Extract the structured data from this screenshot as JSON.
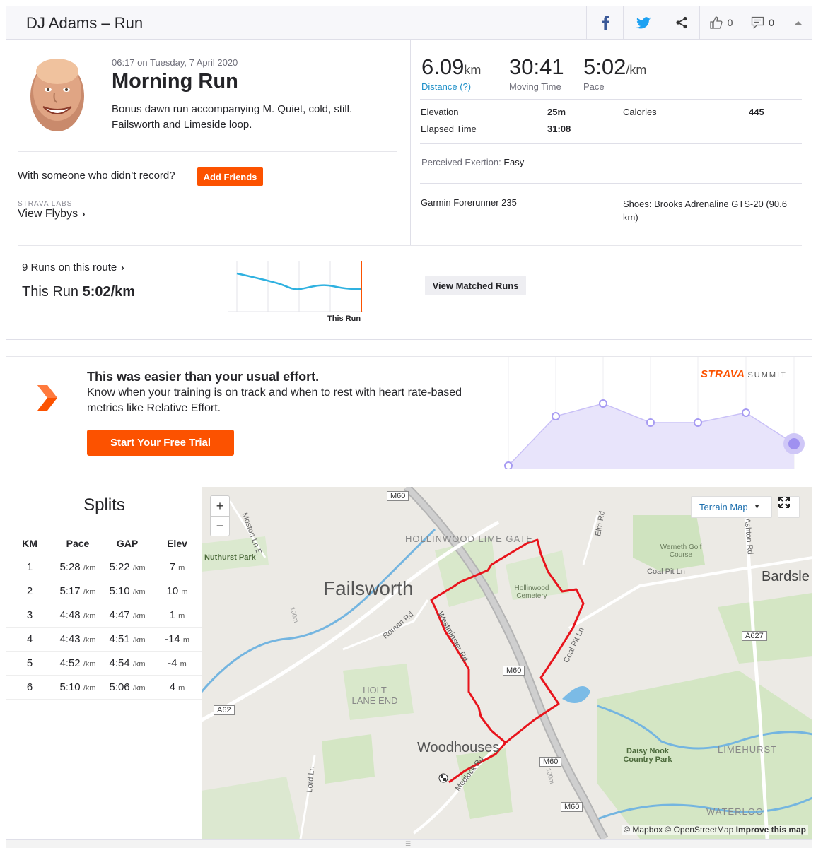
{
  "header": {
    "title": "DJ Adams – Run",
    "kudos_count": "0",
    "comments_count": "0",
    "icons": [
      "facebook-icon",
      "twitter-icon",
      "share-icon",
      "thumbs-up-icon",
      "comment-icon",
      "collapse-icon"
    ]
  },
  "activity": {
    "datetime": "06:17 on Tuesday, 7 April 2020",
    "name": "Morning Run",
    "description": "Bonus dawn run accompanying M. Quiet, cold, still. Failsworth and Limeside loop.",
    "with_someone": "With someone who didn’t record?",
    "add_friends": "Add Friends",
    "labs_label": "STRAVA LABS",
    "flybys": "View Flybys"
  },
  "stats": {
    "distance": {
      "value": "6.09",
      "unit": "km",
      "label": "Distance (?)"
    },
    "moving_time": {
      "value": "30:41",
      "label": "Moving Time"
    },
    "pace": {
      "value": "5:02",
      "unit": "/km",
      "label": "Pace"
    },
    "elevation_label": "Elevation",
    "elevation_value": "25m",
    "calories_label": "Calories",
    "calories_value": "445",
    "elapsed_label": "Elapsed Time",
    "elapsed_value": "31:08",
    "perceived_label": "Perceived Exertion:",
    "perceived_value": "Easy",
    "device": "Garmin Forerunner 235",
    "shoes": "Shoes: Brooks Adrenaline GTS-20 (90.6 km)"
  },
  "route": {
    "runs_on_route": "9 Runs on this route",
    "this_run_prefix": "This Run",
    "this_run_value": "5:02/km",
    "this_run_label": "This Run",
    "view_matched": "View Matched Runs"
  },
  "upsell": {
    "title": "This was easier than your usual effort.",
    "text": "Know when your training is on track and when to rest with heart rate-based metrics like Relative Effort.",
    "button": "Start Your Free Trial",
    "brand_strava": "STRAVA",
    "brand_summit": "SUMMIT"
  },
  "splits": {
    "title": "Splits",
    "columns": [
      "KM",
      "Pace",
      "GAP",
      "Elev"
    ],
    "pace_unit": "/km",
    "elev_unit": "m",
    "rows": [
      {
        "km": "1",
        "pace": "5:28",
        "gap": "5:22",
        "elev": "7"
      },
      {
        "km": "2",
        "pace": "5:17",
        "gap": "5:10",
        "elev": "10"
      },
      {
        "km": "3",
        "pace": "4:48",
        "gap": "4:47",
        "elev": "1"
      },
      {
        "km": "4",
        "pace": "4:43",
        "gap": "4:51",
        "elev": "-14"
      },
      {
        "km": "5",
        "pace": "4:52",
        "gap": "4:54",
        "elev": "-4"
      },
      {
        "km": "6",
        "pace": "5:10",
        "gap": "5:06",
        "elev": "4"
      }
    ]
  },
  "map": {
    "zoom_in": "+",
    "zoom_out": "−",
    "map_type": "Terrain Map",
    "attribution": "© Mapbox © OpenStreetMap",
    "improve": "Improve this map",
    "labels": {
      "failsworth": "Failsworth",
      "woodhouses": "Woodhouses",
      "bardsley": "Bardsle",
      "hollinwood_lime_gate": "HOLLINWOOD LIME GATE",
      "hollinwood_cemetery": "Hollinwood Cemetery",
      "werneth_golf": "Werneth Golf Course",
      "coal_pit_ln": "Coal Pit Ln",
      "coal_pit_ln_2": "Coal Pit Ln",
      "nuthurst_park": "Nuthurst Park",
      "moston_ln_e": "Moston Ln E",
      "roman_rd": "Roman Rd",
      "westminster_rd": "Westminster Rd",
      "holt_lane_end": "HOLT LANE END",
      "medlock_rd": "Medlock Rd",
      "daisy_nook": "Daisy Nook Country Park",
      "limehurst": "LIMEHURST",
      "waterloo": "WATERLOO",
      "elm_rd": "Elm Rd",
      "ashton_rd": "Ashton Rd",
      "lord_ln": "Lord Ln",
      "m60": "M60",
      "a62": "A62",
      "a627": "A627",
      "contour_100m": "100m"
    }
  },
  "colors": {
    "strava_orange": "#fc5200",
    "route_red": "#e8141c",
    "link_blue": "#1d8fc8",
    "effort_purple": "#a79bf2"
  }
}
